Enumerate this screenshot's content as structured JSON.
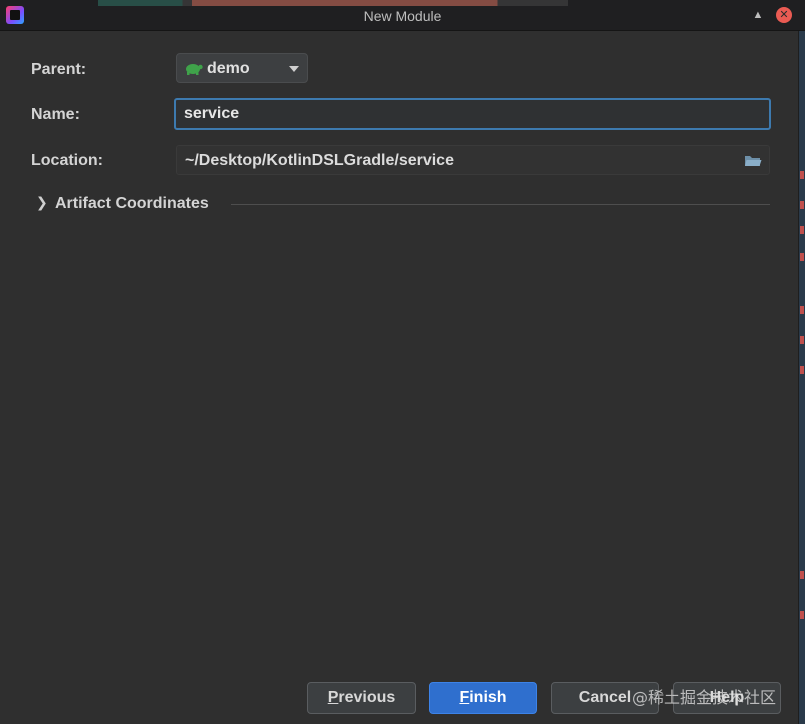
{
  "window": {
    "title": "New Module"
  },
  "form": {
    "parent_label": "Parent:",
    "parent_value": "demo",
    "name_label": "Name:",
    "name_value": "service",
    "location_label": "Location:",
    "location_value": "~/Desktop/KotlinDSLGradle/service",
    "artifact_label": "Artifact Coordinates"
  },
  "buttons": {
    "previous": {
      "first": "P",
      "rest": "revious"
    },
    "finish": {
      "first": "F",
      "rest": "inish"
    },
    "cancel": "Cancel",
    "help": "Help"
  },
  "watermark": "@稀土掘金技术社区",
  "icons": {
    "app": "intellij-icon",
    "collapse": "triangle-up-icon",
    "close": "close-icon",
    "parent": "gradle-turtle-icon",
    "dropdown": "triangle-down-icon",
    "browse": "folder-icon",
    "expand": "chevron-right-icon"
  },
  "colors": {
    "accent": "#2f6fce",
    "focus_border": "#3d7aaf",
    "close_button": "#ea5b53",
    "gradle_icon": "#3fa24a"
  }
}
